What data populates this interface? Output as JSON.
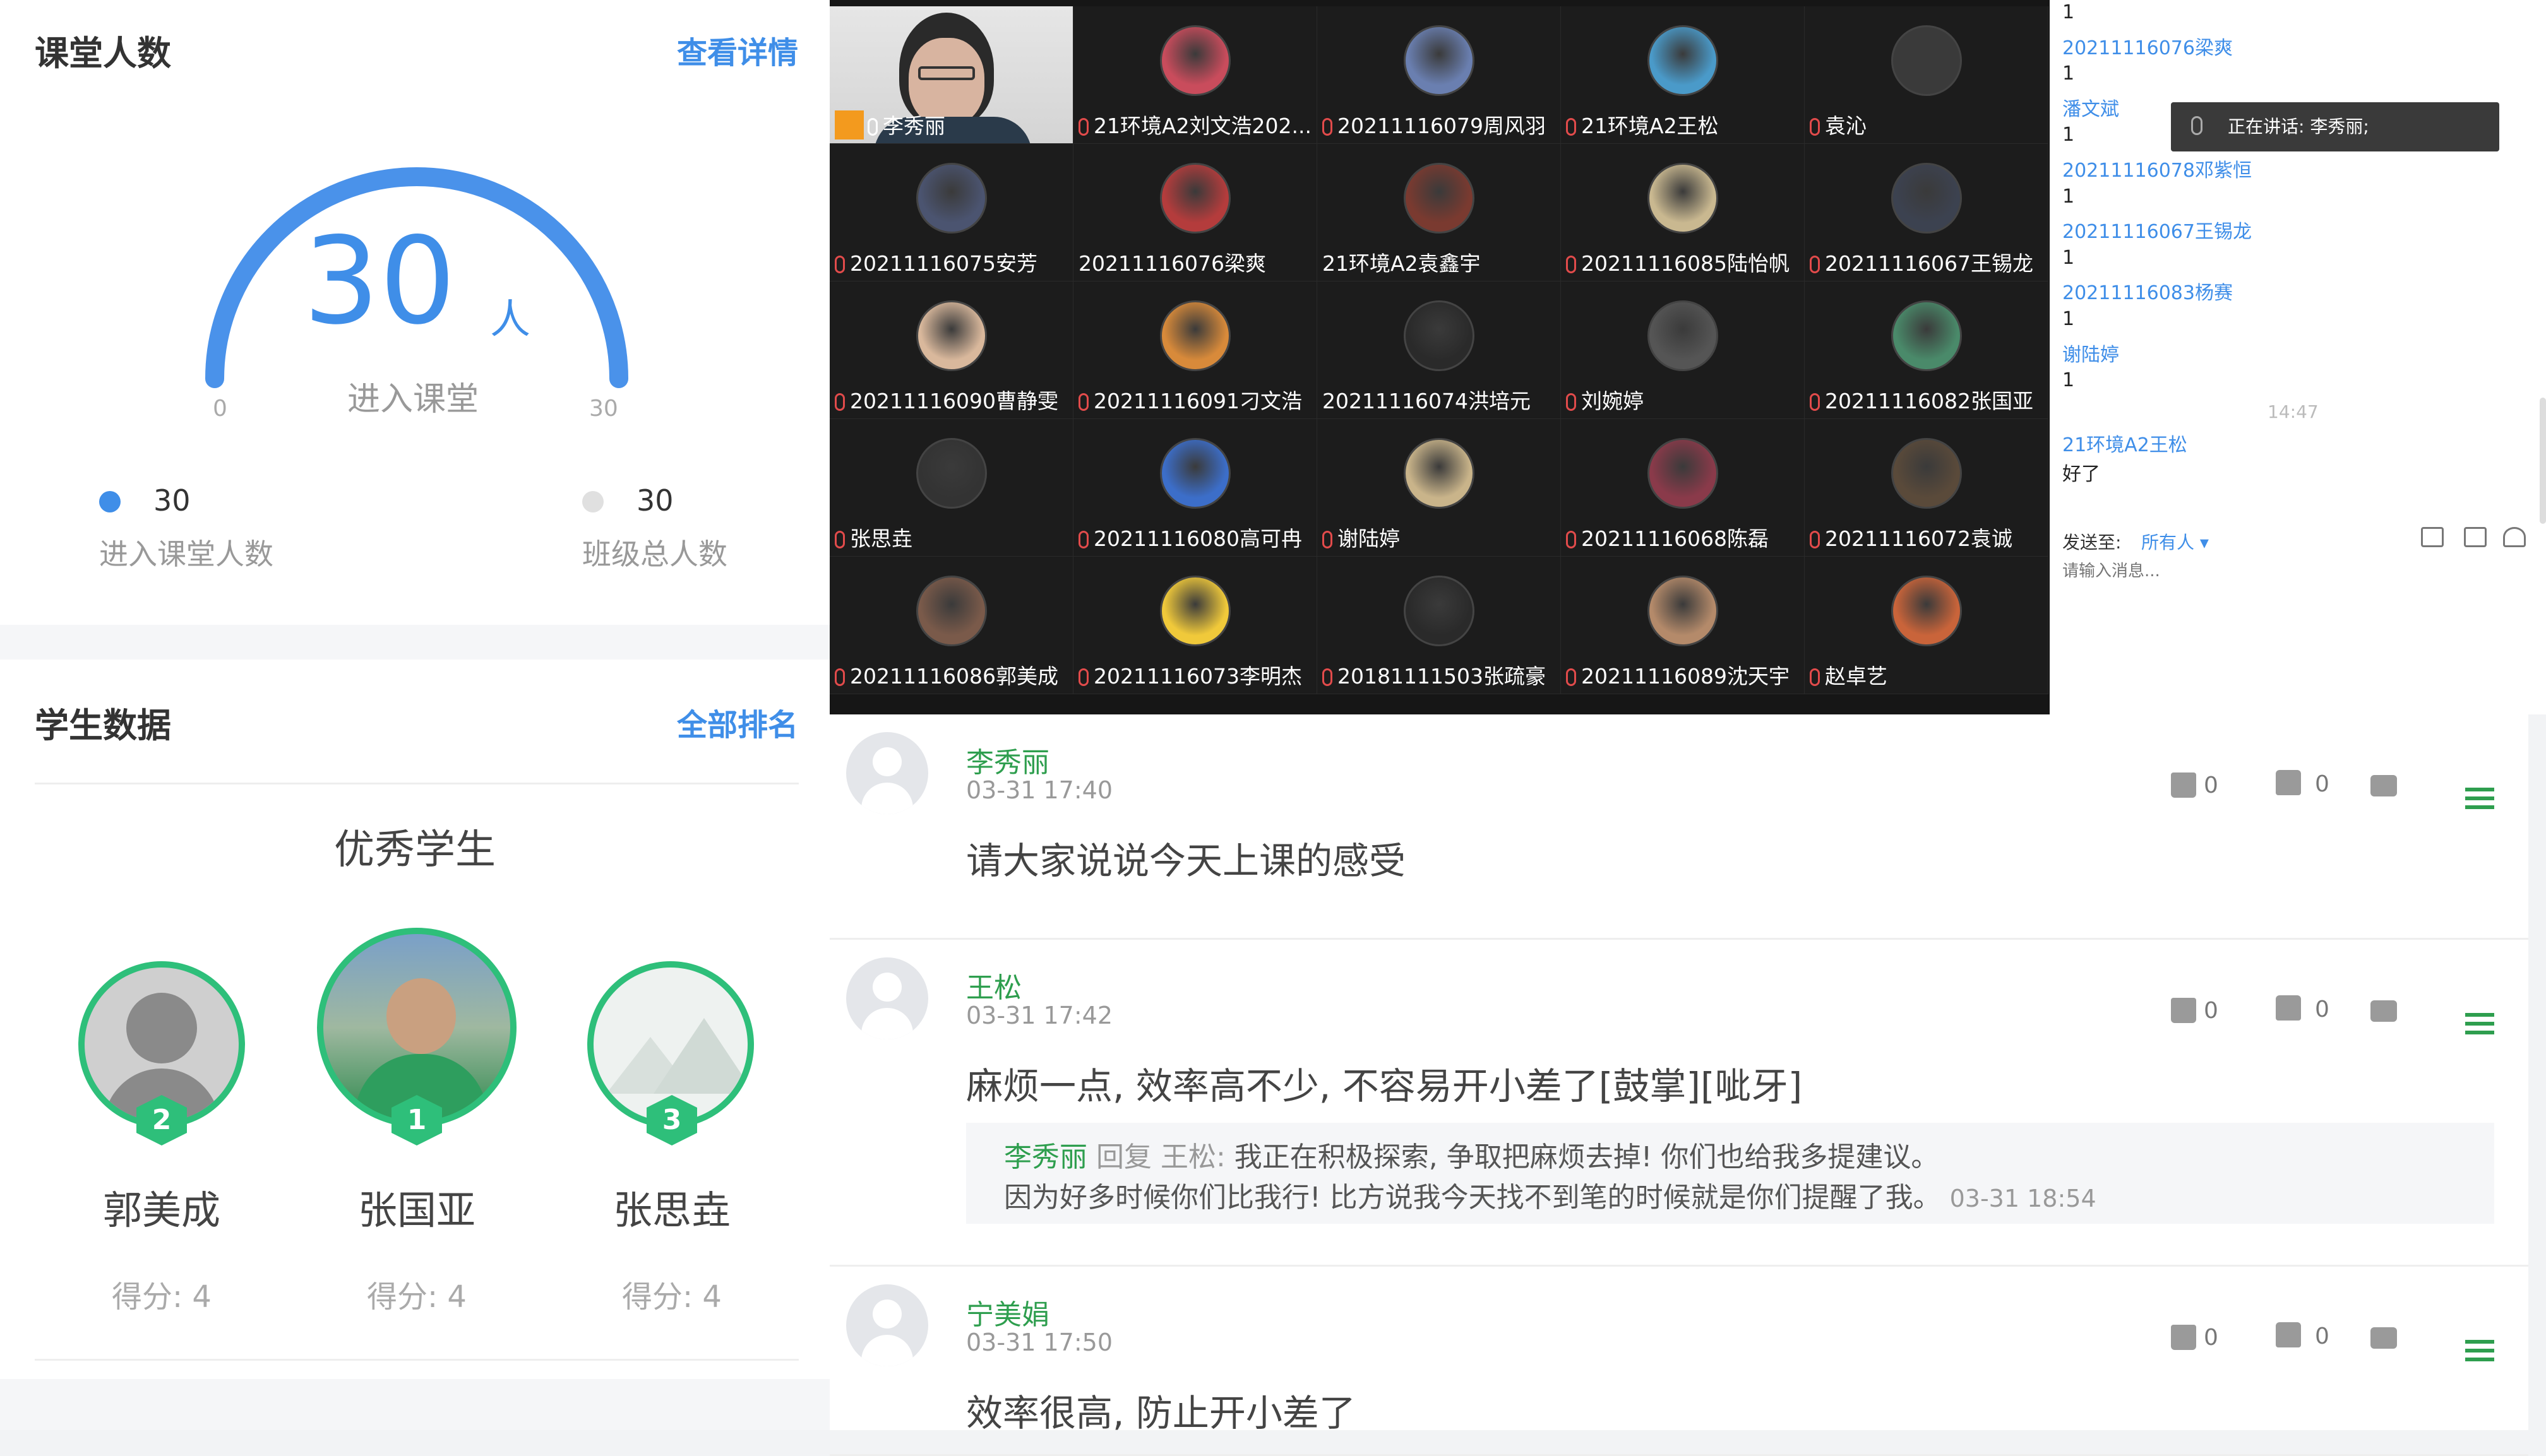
{
  "left": {
    "attendance": {
      "title": "课堂人数",
      "link": "查看详情",
      "count": "30",
      "unit": "人",
      "caption": "进入课堂",
      "min": "0",
      "max": "30",
      "fill_fraction": 1.0,
      "legend": [
        {
          "value": "30",
          "label": "进入课堂人数",
          "color": "#3f8ee8"
        },
        {
          "value": "30",
          "label": "班级总人数",
          "color": "#e0e0e0"
        }
      ]
    },
    "students": {
      "title": "学生数据",
      "link": "全部排名",
      "heading": "优秀学生",
      "top": [
        {
          "rank": "2",
          "name": "郭美成",
          "score": "得分: 4"
        },
        {
          "rank": "1",
          "name": "张国亚",
          "score": "得分: 4"
        },
        {
          "rank": "3",
          "name": "张思垚",
          "score": "得分: 4"
        }
      ]
    }
  },
  "grid": {
    "tiles": [
      {
        "label": "李秀丽",
        "teacher": true
      },
      {
        "label": "21环境A2刘文浩202...",
        "color": "#c94c5c"
      },
      {
        "label": "20211116079周风羽",
        "color": "#6a7fb0"
      },
      {
        "label": "21环境A2王松",
        "color": "#4a9ac9"
      },
      {
        "label": "袁沁",
        "color": "#3a3a3a"
      },
      {
        "label": "20211116075安芳",
        "color": "#4b5470"
      },
      {
        "label": "20211116076梁爽",
        "color": "#b43c3c",
        "nomic": true
      },
      {
        "label": "21环境A2袁鑫宇",
        "color": "#7a3a30",
        "nomic": true
      },
      {
        "label": "20211116085陆怡帆",
        "color": "#c9b890"
      },
      {
        "label": "20211116067王锡龙",
        "color": "#3c4250"
      },
      {
        "label": "20211116090曹静雯",
        "color": "#d9b89c"
      },
      {
        "label": "20211116091刁文浩",
        "color": "#d88a3a"
      },
      {
        "label": "20211116074洪培元",
        "color": "#2a2a2a",
        "nomic": true
      },
      {
        "label": "刘婉婷",
        "color": "#555555"
      },
      {
        "label": "20211116082张国亚",
        "color": "#4a8a6a"
      },
      {
        "label": "张思垚",
        "color": "#333333"
      },
      {
        "label": "20211116080高可冉",
        "color": "#3c6ec9"
      },
      {
        "label": "谢陆婷",
        "color": "#c9b48a"
      },
      {
        "label": "20211116068陈磊",
        "color": "#8a3a4a"
      },
      {
        "label": "20211116072袁诚",
        "color": "#5a4a3a"
      },
      {
        "label": "20211116086郭美成",
        "color": "#7a5a4a"
      },
      {
        "label": "20211116073李明杰",
        "color": "#f0c93a"
      },
      {
        "label": "20181111503张疏豪",
        "color": "#2a2a2a"
      },
      {
        "label": "20211116089沈天宇",
        "color": "#b48a6a"
      },
      {
        "label": "赵卓艺",
        "color": "#c9643a"
      }
    ]
  },
  "chat": {
    "lines": [
      {
        "t": "1",
        "k": "msg"
      },
      {
        "t": "20211116076梁爽",
        "k": "name"
      },
      {
        "t": "1",
        "k": "msg"
      },
      {
        "t": "潘文斌",
        "k": "name"
      },
      {
        "t": "1",
        "k": "msg"
      },
      {
        "t": "20211116078邓紫恒",
        "k": "name"
      },
      {
        "t": "1",
        "k": "msg"
      },
      {
        "t": "20211116067王锡龙",
        "k": "name"
      },
      {
        "t": "1",
        "k": "msg"
      },
      {
        "t": "20211116083杨赛",
        "k": "name"
      },
      {
        "t": "1",
        "k": "msg"
      },
      {
        "t": "谢陆婷",
        "k": "name"
      },
      {
        "t": "1",
        "k": "msg"
      }
    ],
    "speaking": "正在讲话: 李秀丽;",
    "time": "14:47",
    "last_name": "21环境A2王松",
    "last_msg": "好了",
    "send_to_label": "发送至:",
    "send_to_value": "所有人 ▾",
    "input_placeholder": "请输入消息..."
  },
  "comments": [
    {
      "name": "李秀丽",
      "time": "03-31 17:40",
      "text": "请大家说说今天上课的感受",
      "dislikes": "0",
      "likes": "0"
    },
    {
      "name": "王松",
      "time": "03-31 17:42",
      "text": "麻烦一点, 效率高不少, 不容易开小差了[鼓掌][呲牙]",
      "dislikes": "0",
      "likes": "0",
      "reply": {
        "from": "李秀丽",
        "verb": "回复",
        "to": "王松:",
        "line1": "我正在积极探索, 争取把麻烦去掉! 你们也给我多提建议。",
        "line2": "因为好多时候你们比我行! 比方说我今天找不到笔的时候就是你们提醒了我。",
        "time": "03-31 18:54"
      }
    },
    {
      "name": "宁美娟",
      "time": "03-31 17:50",
      "text": "效率很高, 防止开小差了",
      "dislikes": "0",
      "likes": "0"
    }
  ]
}
